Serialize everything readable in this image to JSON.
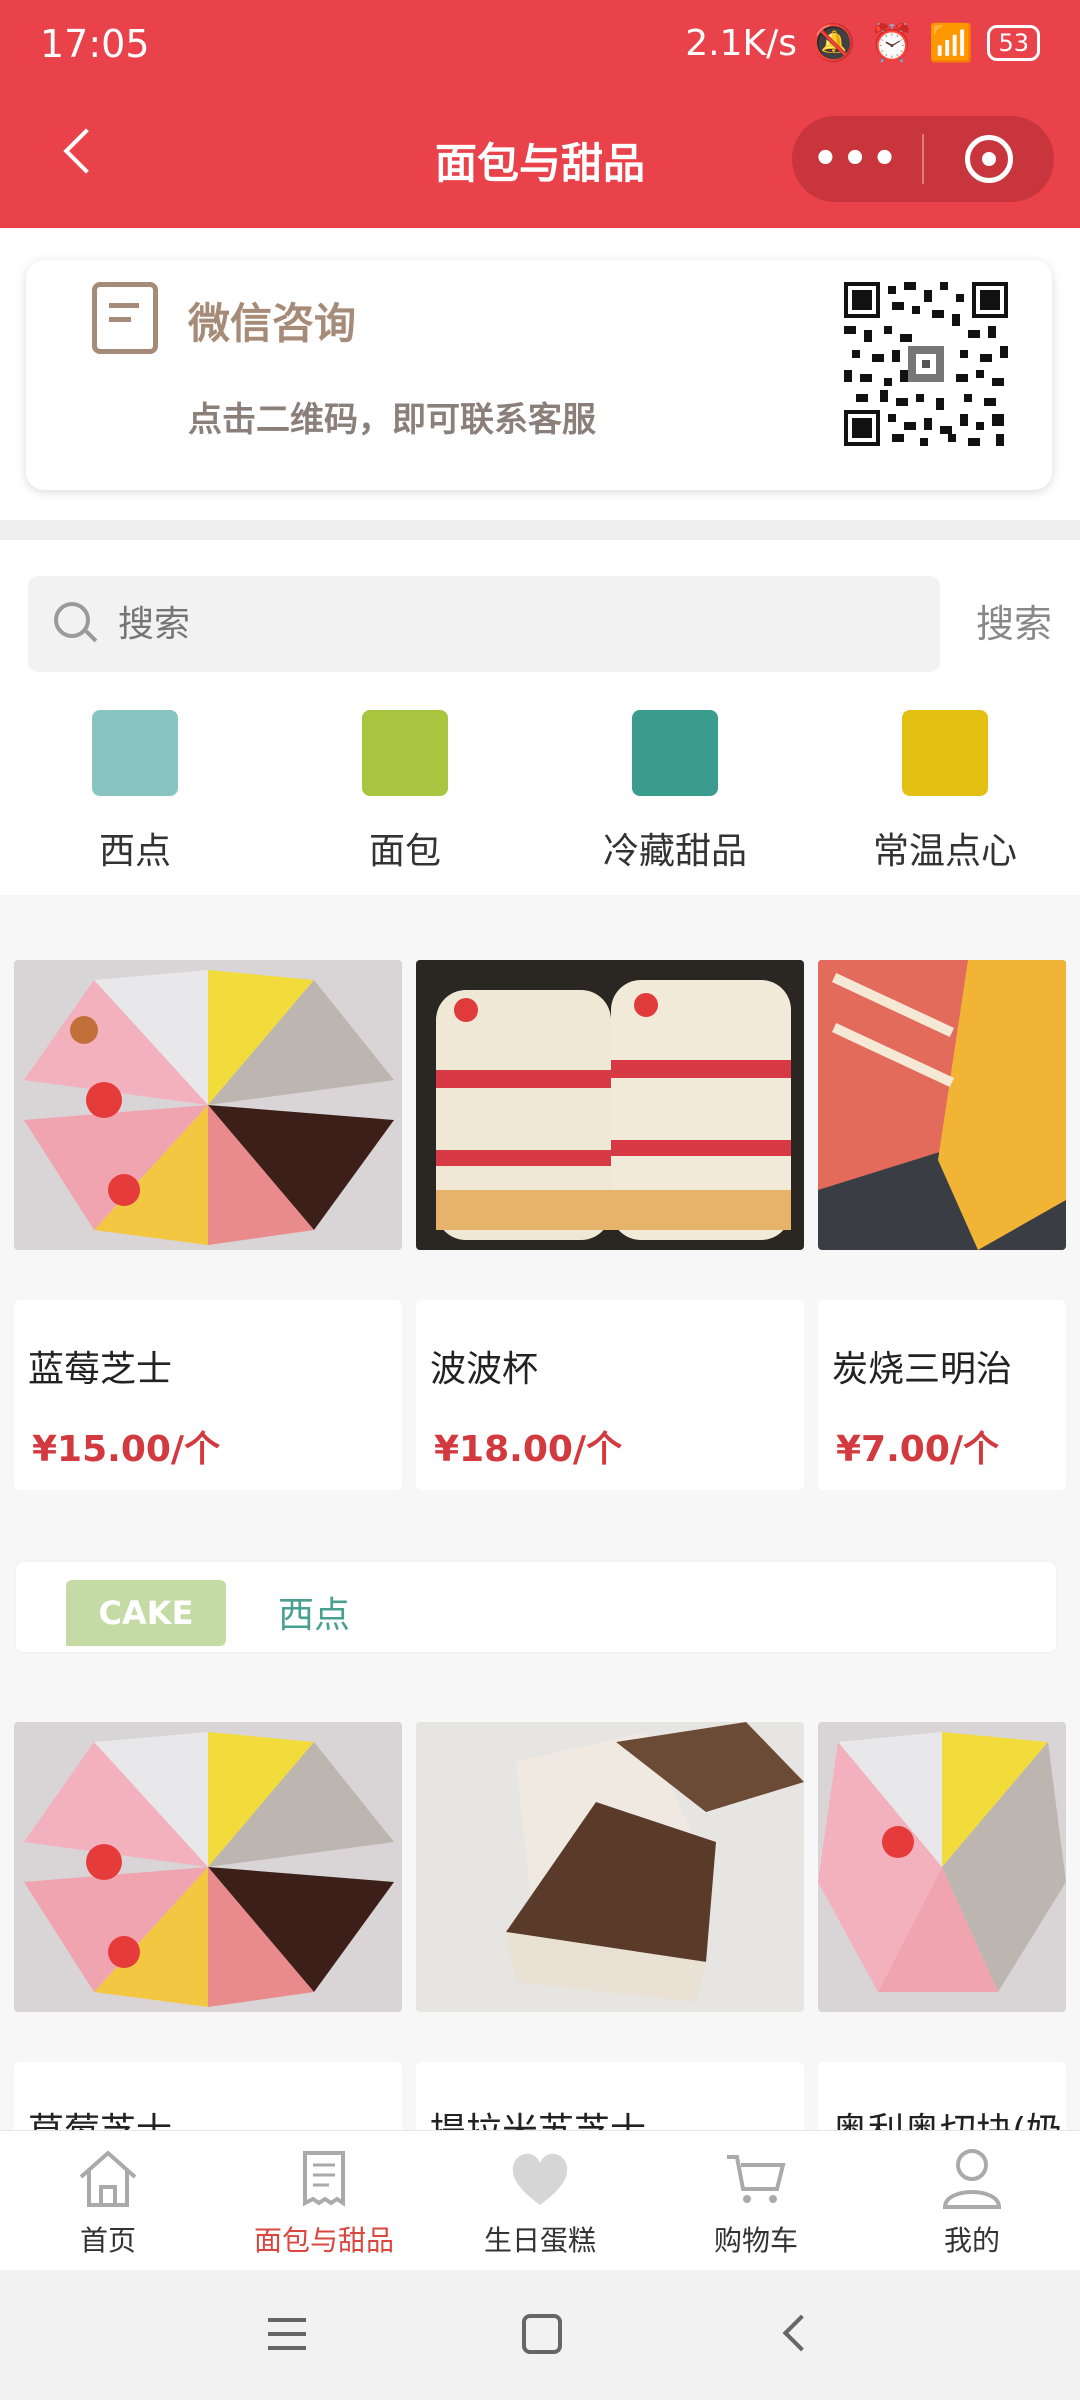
{
  "status_bar": {
    "time": "17:05",
    "network": "2.1K/s",
    "battery": "53"
  },
  "nav": {
    "title": "面包与甜品",
    "more_glyph": "•••"
  },
  "consult": {
    "title": "微信咨询",
    "subtitle": "点击二维码，即可联系客服"
  },
  "search": {
    "placeholder": "搜索",
    "button": "搜索"
  },
  "categories": [
    {
      "label": "西点",
      "color": "#88c4c0"
    },
    {
      "label": "面包",
      "color": "#a9c43e"
    },
    {
      "label": "冷藏甜品",
      "color": "#3a9c8c"
    },
    {
      "label": "常温点心",
      "color": "#e4c013"
    }
  ],
  "products_top": [
    {
      "name": "蓝莓芝士",
      "price": "¥15.00/个"
    },
    {
      "name": "波波杯",
      "price": "¥18.00/个"
    },
    {
      "name": "炭烧三明治",
      "price": "¥7.00/个"
    }
  ],
  "section": {
    "tag": "CAKE",
    "label": "西点"
  },
  "products_bottom": [
    {
      "name": "草莓芝士"
    },
    {
      "name": "提拉米苏芝士"
    },
    {
      "name": "奥利奥切块(奶"
    }
  ],
  "tabs": [
    {
      "label": "首页",
      "icon": "home-icon",
      "active": false
    },
    {
      "label": "面包与甜品",
      "icon": "receipt-icon",
      "active": true
    },
    {
      "label": "生日蛋糕",
      "icon": "heart-icon",
      "active": false
    },
    {
      "label": "购物车",
      "icon": "cart-icon",
      "active": false
    },
    {
      "label": "我的",
      "icon": "user-icon",
      "active": false
    }
  ],
  "colors": {
    "brand_red": "#e9424a",
    "price_red": "#d33a3f",
    "active_tab": "#d9473f",
    "consult_brown": "#a58b78"
  }
}
